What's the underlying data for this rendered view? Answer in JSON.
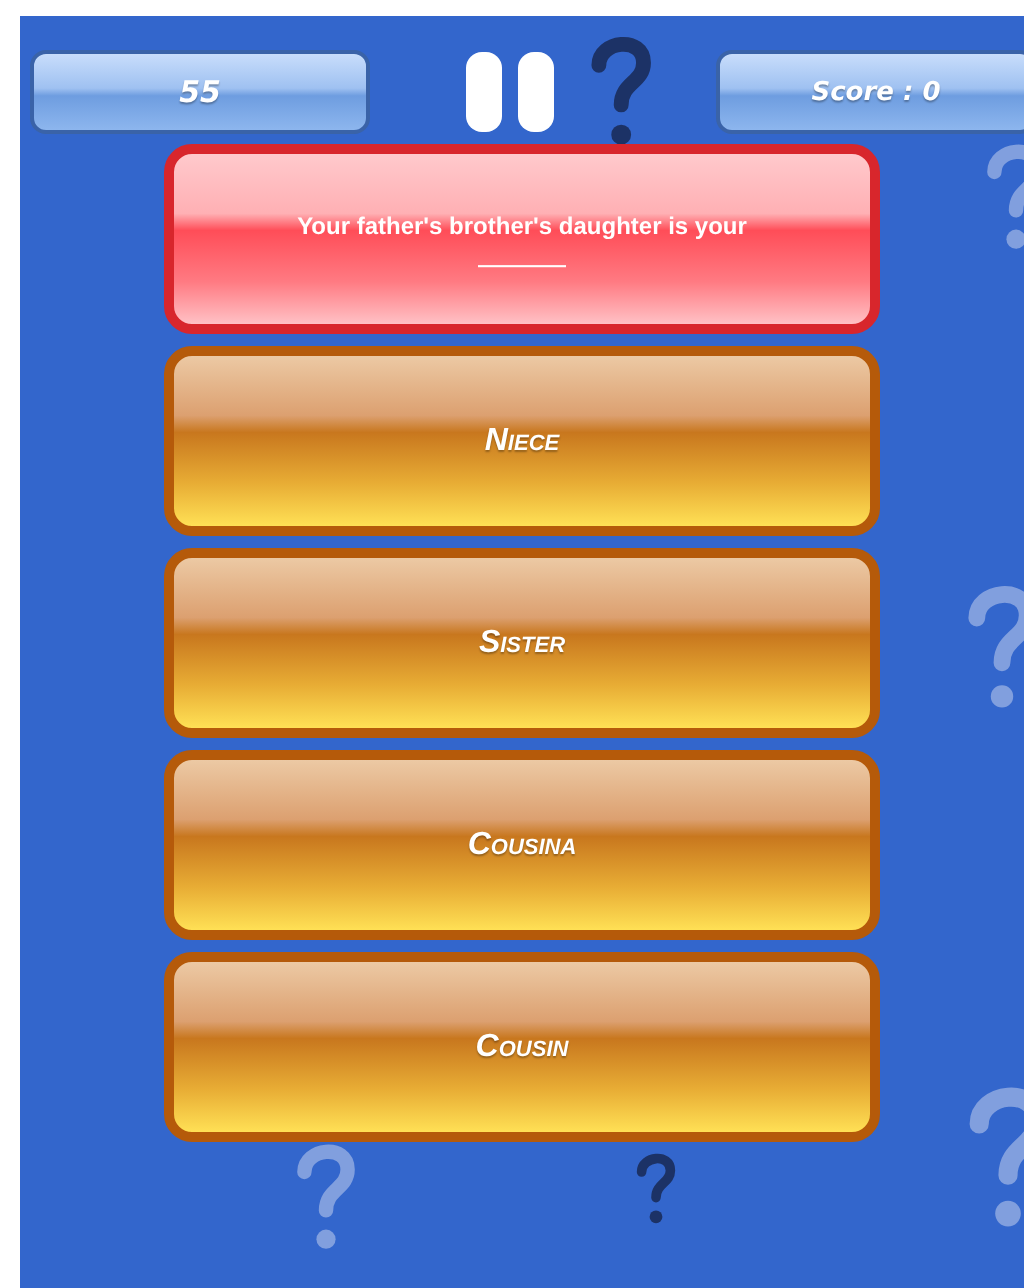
{
  "timer": {
    "value": "55"
  },
  "score": {
    "label": "Score : 0"
  },
  "question": {
    "text": "Your father's brother's daughter is your",
    "blank": "________"
  },
  "answers": [
    {
      "label": "Niece"
    },
    {
      "label": "Sister"
    },
    {
      "label": "Cousina"
    },
    {
      "label": "Cousin"
    }
  ]
}
